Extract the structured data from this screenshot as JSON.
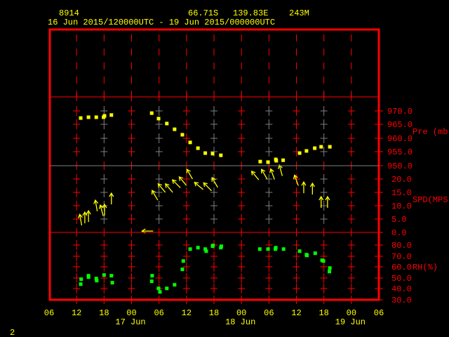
{
  "header": {
    "station": "8914",
    "lat": "66.71S",
    "lon": "139.83E",
    "elev": "243M",
    "range": "16 Jun 2015/120000UTC - 19 Jun 2015/000000UTC"
  },
  "footer": {
    "page": "2"
  },
  "colors": {
    "text": "#ffff00",
    "axis": "#ff0000",
    "grid_alt": "#808080",
    "pressure": "#ffff00",
    "wind": "#ffff00",
    "rh": "#00ff00"
  },
  "chart_data": [
    {
      "type": "scatter",
      "title": "Pre (mb)",
      "ylabel": "Pre (mb)",
      "ylim": [
        945,
        975
      ],
      "ticks": [
        "970.0",
        "965.0",
        "960.0",
        "955.0",
        "950.0"
      ],
      "x_hours_since": "16 Jun 06 UTC",
      "x": [
        6.9,
        8.6,
        10.3,
        11.9,
        12.1,
        13.6,
        22.4,
        23.9,
        25.7,
        27.4,
        29.1,
        30.8,
        32.5,
        34.1,
        35.7,
        37.5,
        46.1,
        47.8,
        49.5,
        49.6,
        51.1,
        54.7,
        56.2,
        58.0,
        59.4,
        61.3
      ],
      "y": [
        967.4,
        967.7,
        967.7,
        967.7,
        968.2,
        968.5,
        969.2,
        967.2,
        965.4,
        963.3,
        961.3,
        958.5,
        956.4,
        954.6,
        954.4,
        953.8,
        951.5,
        951.3,
        952.3,
        951.8,
        952.0,
        954.6,
        955.4,
        956.4,
        956.9,
        956.9
      ]
    },
    {
      "type": "scatter",
      "title": "SPD(MPS)",
      "ylabel": "SPD(MPS)",
      "ylim": [
        0,
        25
      ],
      "ticks": [
        "20.0",
        "15.0",
        "10.0",
        "5.0",
        "0.0"
      ],
      "x": [
        6.9,
        7.8,
        8.6,
        10.3,
        11.5,
        12.1,
        13.6,
        23.1,
        24.6,
        26.2,
        27.8,
        29.2,
        30.7,
        32.7,
        34.6,
        36.2,
        45.0,
        47.0,
        48.8,
        50.6,
        54.0,
        55.6,
        57.5,
        59.4,
        60.8
      ],
      "y": [
        4.7,
        5.5,
        6.0,
        10.0,
        8.2,
        8.4,
        12.6,
        13.9,
        16.6,
        16.6,
        18.2,
        19.2,
        21.8,
        17.4,
        17.1,
        18.7,
        21.3,
        21.8,
        21.8,
        23.2,
        19.5,
        16.8,
        16.3,
        11.3,
        11.3
      ],
      "direction_deg": [
        350,
        0,
        0,
        350,
        345,
        0,
        0,
        330,
        320,
        320,
        315,
        320,
        330,
        310,
        315,
        330,
        320,
        330,
        340,
        345,
        340,
        0,
        0,
        0,
        0
      ],
      "calm": {
        "x": 21.5,
        "y": 0.5,
        "direction_deg": 270
      }
    },
    {
      "type": "scatter",
      "title": "RH(%)",
      "ylabel": "RH(%)",
      "ylim": [
        30,
        80
      ],
      "ticks": [
        "80.0",
        "70.0",
        "60.0",
        "50.0",
        "40.0",
        "30.0"
      ],
      "x": [
        7.0,
        6.9,
        8.6,
        8.6,
        10.3,
        10.4,
        12.0,
        13.6,
        13.8,
        22.5,
        22.4,
        23.9,
        24.2,
        25.7,
        27.4,
        29.1,
        29.3,
        30.8,
        32.5,
        34.1,
        34.3,
        35.7,
        35.8,
        37.5,
        37.6,
        46.0,
        47.8,
        49.4,
        49.5,
        51.2,
        54.7,
        56.2,
        56.3,
        58.1,
        59.6,
        59.9,
        61.2,
        61.3
      ],
      "y": [
        48.8,
        44.3,
        52.0,
        50.7,
        49.4,
        47.5,
        52.6,
        52.0,
        45.6,
        52.0,
        46.9,
        40.4,
        37.2,
        40.4,
        43.7,
        57.8,
        65.4,
        76.3,
        77.6,
        76.3,
        74.4,
        78.9,
        79.6,
        77.6,
        78.9,
        76.3,
        76.3,
        76.3,
        77.6,
        76.3,
        74.4,
        71.2,
        70.5,
        72.5,
        66.1,
        65.4,
        55.8,
        59.0
      ]
    }
  ],
  "x_axis": {
    "ticks": [
      "06",
      "12",
      "18",
      "00",
      "06",
      "12",
      "18",
      "00",
      "06",
      "12",
      "18",
      "00",
      "06"
    ],
    "days": [
      "17 Jun",
      "18 Jun",
      "19 Jun"
    ]
  }
}
